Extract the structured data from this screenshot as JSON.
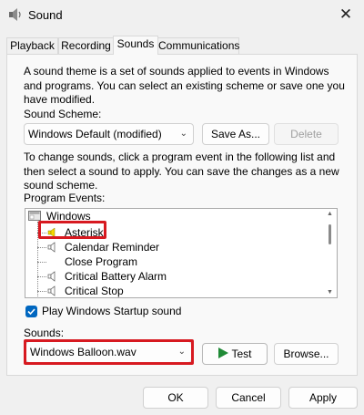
{
  "window": {
    "title": "Sound",
    "close_glyph": "✕"
  },
  "tabs": [
    {
      "label": "Playback"
    },
    {
      "label": "Recording"
    },
    {
      "label": "Sounds"
    },
    {
      "label": "Communications"
    }
  ],
  "sounds": {
    "intro_lines": [
      "A sound theme is a set of sounds applied to events in Windows",
      "and programs.  You can select an existing scheme or save one you",
      "have modified."
    ],
    "scheme_label": "Sound Scheme:",
    "scheme_value": "Windows Default (modified)",
    "save_as_label": "Save As...",
    "delete_label": "Delete",
    "instructions_lines": [
      "To change sounds, click a program event in the following list and",
      "then select a sound to apply.  You can save the changes as a new",
      "sound scheme."
    ],
    "events_label": "Program Events:",
    "events_root": "Windows",
    "events": [
      {
        "label": "Asterisk",
        "has_sound": true
      },
      {
        "label": "Calendar Reminder",
        "has_sound": true
      },
      {
        "label": "Close Program",
        "has_sound": false
      },
      {
        "label": "Critical Battery Alarm",
        "has_sound": true
      },
      {
        "label": "Critical Stop",
        "has_sound": true
      }
    ],
    "startup_checkbox_label": "Play Windows Startup sound",
    "startup_checked": true,
    "sounds_label": "Sounds:",
    "sound_file": "Windows Balloon.wav",
    "test_label": "Test",
    "browse_label": "Browse..."
  },
  "footer": {
    "ok_label": "OK",
    "cancel_label": "Cancel",
    "apply_label": "Apply"
  },
  "colors": {
    "highlight_box": "#d71920",
    "accent": "#0067c0",
    "test_play": "#1f8a36"
  }
}
